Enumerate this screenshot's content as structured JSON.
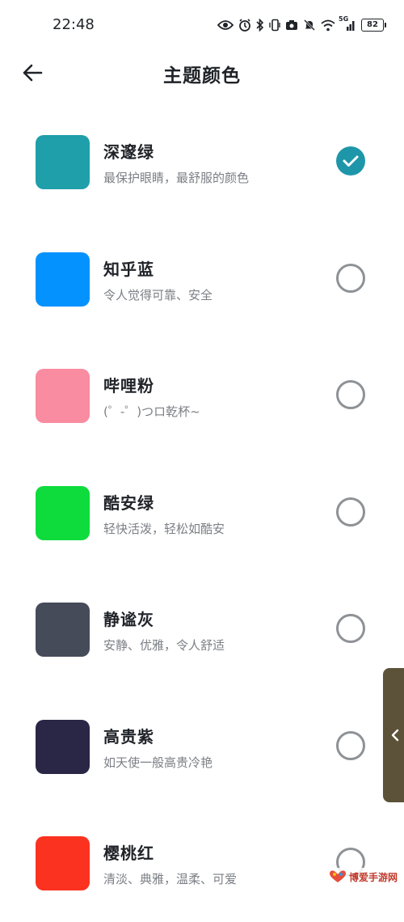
{
  "status_bar": {
    "time": "22:48",
    "battery": "82",
    "icons": [
      "eye-icon",
      "alarm-icon",
      "bluetooth-icon",
      "vibrate-icon",
      "camera-icon",
      "mute-icon",
      "wifi-icon",
      "signal-icon",
      "battery-icon"
    ],
    "network_label": "5G"
  },
  "header": {
    "title": "主题颜色",
    "back_icon": "arrow-left-icon"
  },
  "themes": [
    {
      "name": "深邃绿",
      "desc": "最保护眼睛，最舒服的颜色",
      "color": "#1e9fa9",
      "selected": true
    },
    {
      "name": "知乎蓝",
      "desc": "令人觉得可靠、安全",
      "color": "#0492ff",
      "selected": false
    },
    {
      "name": "哔哩粉",
      "desc": "(゜-゜)つロ乾杯~",
      "color": "#f98ca0",
      "selected": false
    },
    {
      "name": "酷安绿",
      "desc": "轻快活泼，轻松如酷安",
      "color": "#0edb3c",
      "selected": false
    },
    {
      "name": "静谧灰",
      "desc": "安静、优雅，令人舒适",
      "color": "#464b59",
      "selected": false
    },
    {
      "name": "高贵紫",
      "desc": "如天使一般高贵冷艳",
      "color": "#2a2645",
      "selected": false
    },
    {
      "name": "樱桃红",
      "desc": "清淡、典雅，温柔、可爱",
      "color": "#fb3220",
      "selected": false
    }
  ],
  "colors": {
    "accent": "#1e96a9",
    "side_tab": "#5c5239"
  },
  "side_tab": {
    "icon": "chevron-left-icon"
  },
  "watermark": {
    "text": "博爱手游网"
  }
}
